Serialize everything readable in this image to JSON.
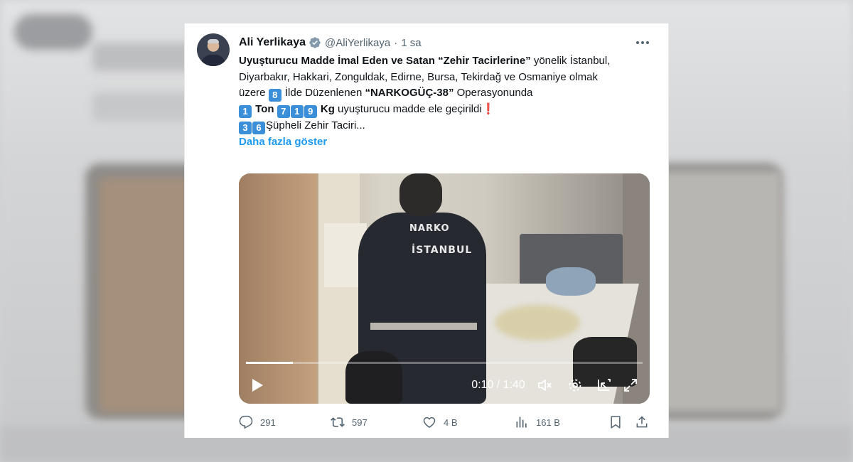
{
  "tweet": {
    "author_name": "Ali Yerlikaya",
    "handle": "@AliYerlikaya",
    "time": "1 sa",
    "line1_bold": "Uyuşturucu Madde İmal Eden ve Satan “Zehir Tacirlerine”",
    "line1_rest": " yönelik İstanbul, Diyarbakır, Hakkari, Zonguldak, Edirne, Bursa, Tekirdağ ve Osmaniye olmak üzere ",
    "keycap_8": "8",
    "line2_mid": " İlde Düzenlenen ",
    "operation_name": "“NARKOGÜÇ-38”",
    "line2_end": " Operasyonunda",
    "keycap_1": "1",
    "ton_label": "Ton",
    "keycap_7": "7",
    "keycap_1b": "1",
    "keycap_9": "9",
    "kg_label": "Kg",
    "seized_text": " uyuşturucu madde ele geçirildi",
    "exclamation": "❗",
    "keycap_3": "3",
    "keycap_6": "6",
    "suspects_text": "Şüpheli Zehir Taciri...",
    "show_more": "Daha fazla göster"
  },
  "video": {
    "vest_text_top": "NARKO",
    "vest_text_bottom": "İSTANBUL",
    "time_display": "0:10 / 1:40",
    "progress_fraction": 0.119
  },
  "actions": {
    "replies": "291",
    "reposts": "597",
    "likes": "4 B",
    "views": "161 B"
  },
  "colors": {
    "link": "#1d9bf0",
    "text_primary": "#0f1419",
    "text_secondary": "#536471",
    "keycap": "#3b8fd8"
  },
  "icons": [
    "verified-badge-icon",
    "more-options-icon",
    "play-icon",
    "volume-icon",
    "settings-icon",
    "pip-icon",
    "fullscreen-icon",
    "reply-icon",
    "repost-icon",
    "like-icon",
    "views-icon",
    "bookmark-icon",
    "share-icon"
  ]
}
